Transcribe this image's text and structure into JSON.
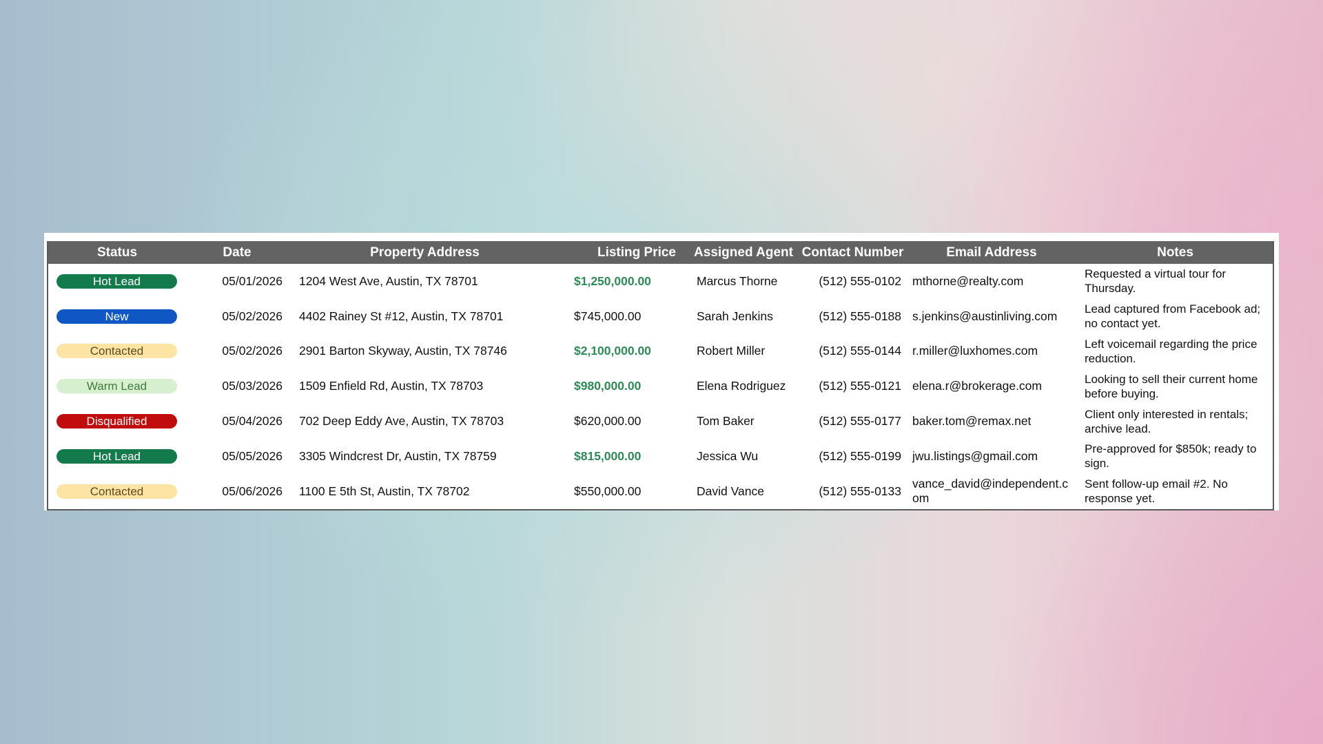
{
  "colors": {
    "header_bg": "#636363",
    "header_text": "#ffffff",
    "price_highlight": "#2e8b57"
  },
  "status_styles": {
    "Hot Lead": {
      "bg": "#137a4b",
      "fg": "#ffffff"
    },
    "New": {
      "bg": "#0f57c5",
      "fg": "#ffffff"
    },
    "Contacted": {
      "bg": "#fde3a4",
      "fg": "#5a4a1a"
    },
    "Warm Lead": {
      "bg": "#d6efcf",
      "fg": "#3f7a3f"
    },
    "Disqualified": {
      "bg": "#c00c0c",
      "fg": "#ffffff"
    }
  },
  "columns": [
    "Status",
    "Date",
    "Property Address",
    "Listing Price",
    "Assigned Agent",
    "Contact Number",
    "Email Address",
    "Notes"
  ],
  "rows": [
    {
      "status": "Hot Lead",
      "date": "05/01/2026",
      "address": "1204 West Ave, Austin, TX 78701",
      "price": "$1,250,000.00",
      "price_highlight": true,
      "agent": "Marcus Thorne",
      "phone": "(512) 555-0102",
      "email": "mthorne@realty.com",
      "notes": "Requested a virtual tour for Thursday."
    },
    {
      "status": "New",
      "date": "05/02/2026",
      "address": "4402 Rainey St #12, Austin, TX 78701",
      "price": "$745,000.00",
      "price_highlight": false,
      "agent": "Sarah Jenkins",
      "phone": "(512) 555-0188",
      "email": "s.jenkins@austinliving.com",
      "notes": "Lead captured from Facebook ad; no contact yet."
    },
    {
      "status": "Contacted",
      "date": "05/02/2026",
      "address": "2901 Barton Skyway, Austin, TX 78746",
      "price": "$2,100,000.00",
      "price_highlight": true,
      "agent": "Robert Miller",
      "phone": "(512) 555-0144",
      "email": "r.miller@luxhomes.com",
      "notes": "Left voicemail regarding the price reduction."
    },
    {
      "status": "Warm Lead",
      "date": "05/03/2026",
      "address": "1509 Enfield Rd, Austin, TX 78703",
      "price": "$980,000.00",
      "price_highlight": true,
      "agent": "Elena Rodriguez",
      "phone": "(512) 555-0121",
      "email": "elena.r@brokerage.com",
      "notes": "Looking to sell their current home before buying."
    },
    {
      "status": "Disqualified",
      "date": "05/04/2026",
      "address": "702 Deep Eddy Ave, Austin, TX 78703",
      "price": "$620,000.00",
      "price_highlight": false,
      "agent": "Tom Baker",
      "phone": "(512) 555-0177",
      "email": "baker.tom@remax.net",
      "notes": "Client only interested in rentals; archive lead."
    },
    {
      "status": "Hot Lead",
      "date": "05/05/2026",
      "address": "3305 Windcrest Dr, Austin, TX 78759",
      "price": "$815,000.00",
      "price_highlight": true,
      "agent": "Jessica Wu",
      "phone": "(512) 555-0199",
      "email": "jwu.listings@gmail.com",
      "notes": "Pre-approved for $850k; ready to sign."
    },
    {
      "status": "Contacted",
      "date": "05/06/2026",
      "address": "1100 E 5th St, Austin, TX 78702",
      "price": "$550,000.00",
      "price_highlight": false,
      "agent": "David Vance",
      "phone": "(512) 555-0133",
      "email": "vance_david@independent.com",
      "notes": "Sent follow-up email #2. No response yet."
    }
  ]
}
